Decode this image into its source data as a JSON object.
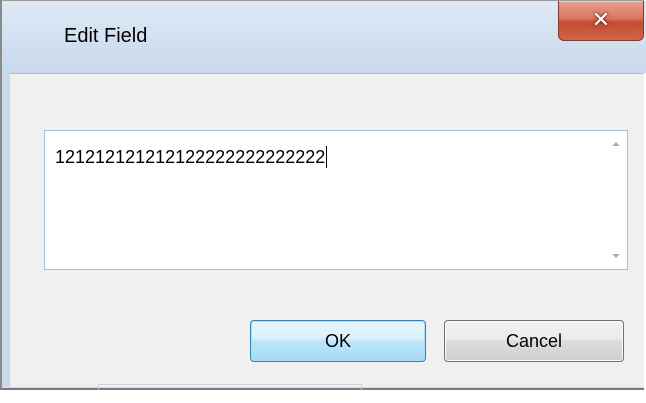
{
  "window": {
    "title": "Edit Field",
    "close_icon": "close-x-icon"
  },
  "field": {
    "value": "121212121212122222222222222"
  },
  "buttons": {
    "ok_label": "OK",
    "cancel_label": "Cancel"
  },
  "colors": {
    "close_button": "#c44a2f",
    "ok_border": "#3c7fb1",
    "titlebar": "#d3e1f1",
    "client_background": "#f0f0f0"
  }
}
